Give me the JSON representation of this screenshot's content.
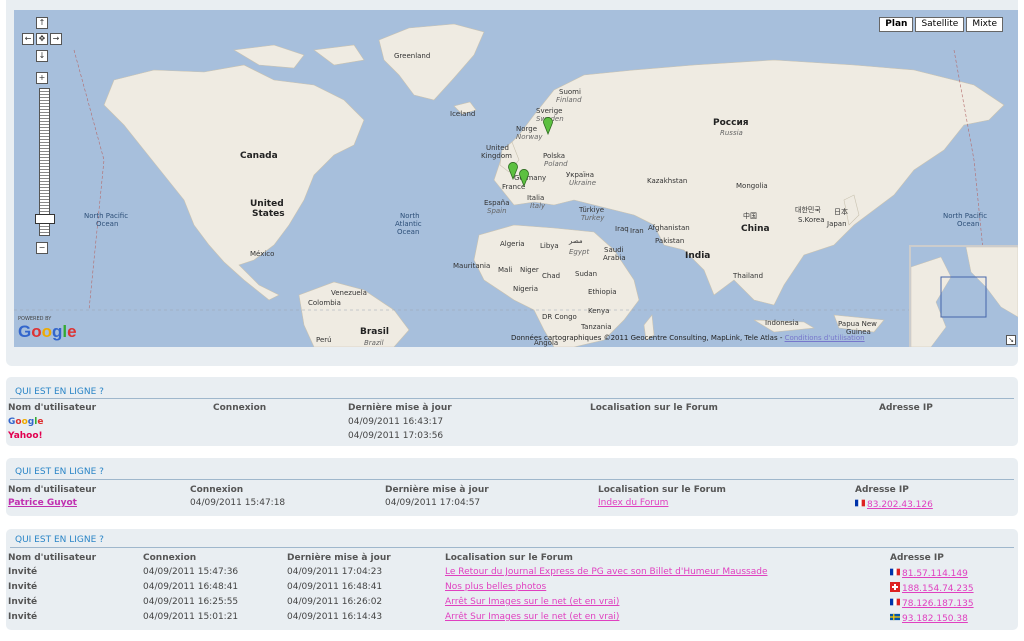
{
  "map": {
    "map_types": [
      "Plan",
      "Satellite",
      "Mixte"
    ],
    "active_type": "Plan",
    "powered_by": "POWERED BY",
    "logo": "Google",
    "copyright": "Données cartographiques ©2011 Geocentre Consulting, MapLink, Tele Atlas -",
    "terms_link": "Conditions d'utilisation",
    "labels": {
      "greenland": "Greenland",
      "iceland": "Iceland",
      "suomi": "Suomi",
      "finland": "Finland",
      "sverige": "Sverige",
      "sweden": "Sweden",
      "norge": "Norge",
      "norway": "Norway",
      "russia": "Россия",
      "russia_it": "Russia",
      "uk1": "United",
      "uk2": "Kingdom",
      "polska": "Polska",
      "poland": "Poland",
      "germany": "Germany",
      "ukraine": "Україна",
      "ukraine_it": "Ukraine",
      "france": "France",
      "espana": "España",
      "spain": "Spain",
      "italia": "Italia",
      "italy": "Italy",
      "turkiye": "Türkiye",
      "turkey": "Turkey",
      "kazakhstan": "Kazakhstan",
      "mongolia": "Mongolia",
      "canada": "Canada",
      "us1": "United",
      "us2": "States",
      "mexico": "México",
      "npo_left1": "North Pacific",
      "npo_left2": "Ocean",
      "nao1": "North",
      "nao2": "Atlantic",
      "nao3": "Ocean",
      "npo_right1": "North Pacific",
      "npo_right2": "Ocean",
      "iraq": "Iraq",
      "iran": "Iran",
      "afghanistan": "Afghanistan",
      "pakistan": "Pakistan",
      "china_cn": "中国",
      "china": "China",
      "korea_kr": "대한민국",
      "skorea": "S.Korea",
      "japan_jp": "日本",
      "japan": "Japan",
      "algeria": "Algeria",
      "libya": "Libya",
      "egypt_ar": "مصر",
      "egypt": "Egypt",
      "saudi1": "Saudi",
      "saudi2": "Arabia",
      "india": "India",
      "mauritania": "Mauritania",
      "mali": "Mali",
      "niger": "Niger",
      "chad": "Chad",
      "sudan": "Sudan",
      "thailand": "Thailand",
      "nigeria": "Nigeria",
      "ethiopia": "Ethiopia",
      "venezuela": "Venezuela",
      "colombia": "Colombia",
      "drcongo": "DR Congo",
      "kenya": "Kenya",
      "tanzania": "Tanzania",
      "indonesia": "Indonesia",
      "png1": "Papua New",
      "png2": "Guinea",
      "brasil": "Brasil",
      "brazil": "Brazil",
      "peru": "Perú",
      "angola": "Angola"
    }
  },
  "sections": [
    {
      "title": "QUI EST EN LIGNE ?",
      "headers": [
        "Nom d'utilisateur",
        "Connexion",
        "Dernière mise à jour",
        "Localisation sur le Forum",
        "Adresse IP"
      ],
      "rows": [
        {
          "name": "Google",
          "connexion": "",
          "update": "04/09/2011 16:43:17",
          "location": "",
          "ip": ""
        },
        {
          "name": "Yahoo!",
          "connexion": "",
          "update": "04/09/2011 17:03:56",
          "location": "",
          "ip": ""
        }
      ]
    },
    {
      "title": "QUI EST EN LIGNE ?",
      "headers": [
        "Nom d'utilisateur",
        "Connexion",
        "Dernière mise à jour",
        "Localisation sur le Forum",
        "Adresse IP"
      ],
      "rows": [
        {
          "name": "Patrice Guyot",
          "connexion": "04/09/2011 15:47:18",
          "update": "04/09/2011 17:04:57",
          "location": "Index du Forum",
          "ip": "83.202.43.126",
          "flag": "france"
        }
      ]
    },
    {
      "title": "QUI EST EN LIGNE ?",
      "headers": [
        "Nom d'utilisateur",
        "Connexion",
        "Dernière mise à jour",
        "Localisation sur le Forum",
        "Adresse IP"
      ],
      "rows": [
        {
          "name": "Invité",
          "connexion": "04/09/2011 15:47:36",
          "update": "04/09/2011 17:04:23",
          "location": "Le Retour du Journal Express de PG avec son Billet d'Humeur Maussade",
          "ip": "81.57.114.149",
          "flag": "france"
        },
        {
          "name": "Invité",
          "connexion": "04/09/2011 16:48:41",
          "update": "04/09/2011 16:48:41",
          "location": "Nos plus belles photos",
          "ip": "188.154.74.235",
          "flag": "switzerland"
        },
        {
          "name": "Invité",
          "connexion": "04/09/2011 16:25:55",
          "update": "04/09/2011 16:26:02",
          "location": "Arrêt Sur Images sur le net (et en vrai)",
          "ip": "78.126.187.135",
          "flag": "france"
        },
        {
          "name": "Invité",
          "connexion": "04/09/2011 15:01:21",
          "update": "04/09/2011 16:14:43",
          "location": "Arrêt Sur Images sur le net (et en vrai)",
          "ip": "93.182.150.38",
          "flag": "sweden"
        }
      ]
    }
  ],
  "colors": {
    "water": "#a7bfdc",
    "land": "#efebe2",
    "accent_title": "#2a85c7",
    "link": "#e040c0",
    "pin": "#5cc040"
  }
}
